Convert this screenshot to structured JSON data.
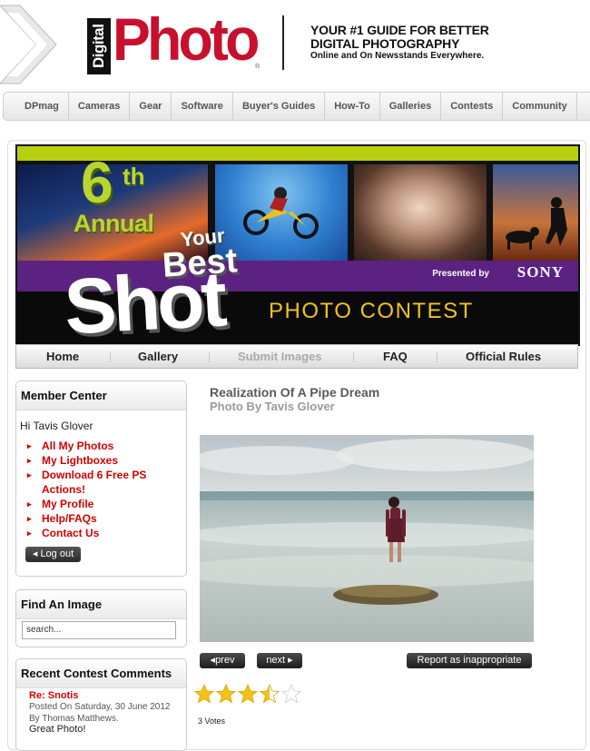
{
  "header": {
    "logo_digital": "Digital",
    "logo_photo": "Photo",
    "logo_reg": "®",
    "tagline_line1": "YOUR #1 GUIDE FOR BETTER",
    "tagline_line2": "DIGITAL PHOTOGRAPHY",
    "tagline_sub": "Online and On Newsstands Everywhere."
  },
  "topnav": {
    "items": [
      "DPmag",
      "Cameras",
      "Gear",
      "Software",
      "Buyer's Guides",
      "How-To",
      "Galleries",
      "Contests",
      "Community"
    ]
  },
  "banner": {
    "num": "6",
    "ordinal": "th",
    "annual": "Annual",
    "your": "Your",
    "best": "Best",
    "shot": "Shot",
    "presented_by": "Presented by",
    "sponsor": "SONY",
    "contest": "PHOTO CONTEST"
  },
  "contest_nav": {
    "home": "Home",
    "gallery": "Gallery",
    "submit": "Submit Images",
    "faq": "FAQ",
    "rules": "Official Rules"
  },
  "member_center": {
    "title": "Member Center",
    "greeting": "Hi Tavis Glover",
    "links": [
      "All My Photos",
      "My Lightboxes",
      "Download 6 Free PS",
      "Actions!",
      "My Profile",
      "Help/FAQs",
      "Contact Us"
    ],
    "logout": "Log out"
  },
  "find_image": {
    "title": "Find An Image",
    "search_value": "search..."
  },
  "recent_comments": {
    "title": "Recent Contest Comments",
    "comment_title": "Re: Snotis",
    "posted_on": "Posted On Saturday, 30 June 2012",
    "by": "By Thomas Matthews.",
    "text": "Great Photo!"
  },
  "photo": {
    "title": "Realization Of A Pipe Dream",
    "byline": "Photo By Tavis Glover"
  },
  "actions": {
    "prev": "prev",
    "next": "next",
    "report": "Report as inappropriate"
  },
  "rating": {
    "value": 3.5,
    "max": 5,
    "votes_label": "3 Votes"
  },
  "colors": {
    "brand_red": "#c8102e",
    "link_red": "#d40000",
    "banner_purple": "#5c2282",
    "banner_green": "#b7cf0e",
    "contest_yellow": "#f2c418"
  }
}
